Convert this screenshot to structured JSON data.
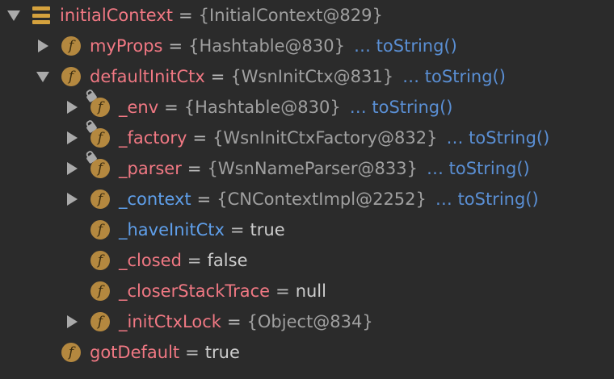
{
  "rows": [
    {
      "name": "initialContext",
      "value": "{InitialContext@829}",
      "to_string": ""
    },
    {
      "name": "myProps",
      "value": "{Hashtable@830}",
      "to_string": "… toString()"
    },
    {
      "name": "defaultInitCtx",
      "value": "{WsnInitCtx@831}",
      "to_string": "… toString()"
    },
    {
      "name": "_env",
      "value": "{Hashtable@830}",
      "to_string": "… toString()"
    },
    {
      "name": "_factory",
      "value": "{WsnInitCtxFactory@832}",
      "to_string": "… toString()"
    },
    {
      "name": "_parser",
      "value": "{WsnNameParser@833}",
      "to_string": "… toString()"
    },
    {
      "name": "_context",
      "value": "{CNContextImpl@2252}",
      "to_string": "… toString()"
    },
    {
      "name": "_haveInitCtx",
      "value": "true",
      "to_string": ""
    },
    {
      "name": "_closed",
      "value": "false",
      "to_string": ""
    },
    {
      "name": "_closerStackTrace",
      "value": "null",
      "to_string": ""
    },
    {
      "name": "_initCtxLock",
      "value": "{Object@834}",
      "to_string": ""
    },
    {
      "name": "gotDefault",
      "value": "true",
      "to_string": ""
    }
  ],
  "eq_sign": "=",
  "field_icon_glyph": "f",
  "colors": {
    "background": "#2b2b2b",
    "field_name": "#f07883",
    "modified_field_name": "#5f9fea",
    "value": "#a0a0a0",
    "link": "#5a8fd4",
    "field_icon": "#b4883f",
    "static_icon": "#d4a13d"
  }
}
